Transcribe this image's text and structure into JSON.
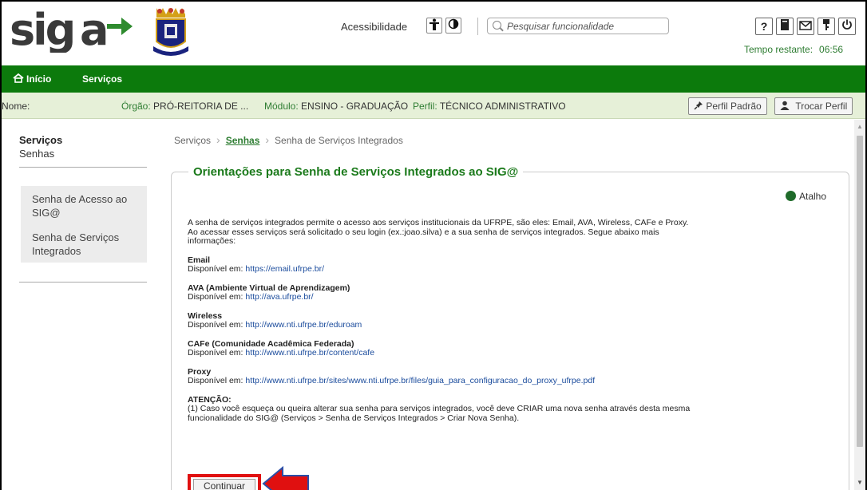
{
  "header": {
    "logo_text": "SIG@",
    "accessibility_label": "Acessibilidade",
    "search_placeholder": "Pesquisar funcionalidade",
    "timer_label": "Tempo restante:",
    "timer_value": "06:56"
  },
  "nav": {
    "home_label": "Início",
    "services_label": "Serviços"
  },
  "infobar": {
    "name_label": "Nome:",
    "orgao_label": "Órgão:",
    "orgao_value": "PRÓ-REITORIA DE ...",
    "modulo_label": "Módulo:",
    "modulo_value": "ENSINO - GRADUAÇÃO",
    "perfil_label": "Perfil:",
    "perfil_value": "TÉCNICO ADMINISTRATIVO",
    "perfil_padrao": "Perfil Padrão",
    "trocar_perfil": "Trocar Perfil"
  },
  "sidebar": {
    "title": "Serviços",
    "subtitle": "Senhas",
    "items": [
      {
        "label": "Senha de Acesso ao SIG@"
      },
      {
        "label": "Senha de Serviços Integrados"
      }
    ]
  },
  "breadcrumb": {
    "item1": "Serviços",
    "item2": "Senhas",
    "item3": "Senha de Serviços Integrados"
  },
  "content": {
    "legend": "Orientações para Senha de Serviços Integrados ao SIG@",
    "atalho": "Atalho",
    "intro": "A senha de serviços integrados permite o acesso aos serviços institucionais da UFRPE, são eles: Email, AVA, Wireless, CAFe e Proxy. Ao acessar esses serviços será solicitado o seu login (ex.:joao.silva) e a sua senha de serviços integrados. Segue abaixo mais informações:",
    "available_label": "Disponível em:",
    "services": [
      {
        "name": "Email",
        "url": "https://email.ufrpe.br/"
      },
      {
        "name": "AVA (Ambiente Virtual de Aprendizagem)",
        "url": "http://ava.ufrpe.br/"
      },
      {
        "name": "Wireless",
        "url": "http://www.nti.ufrpe.br/eduroam"
      },
      {
        "name": "CAFe (Comunidade Acadêmica Federada)",
        "url": "http://www.nti.ufrpe.br/content/cafe"
      },
      {
        "name": "Proxy",
        "url": "http://www.nti.ufrpe.br/sites/www.nti.ufrpe.br/files/guia_para_configuracao_do_proxy_ufrpe.pdf"
      }
    ],
    "attention_title": "ATENÇÃO:",
    "attention_text": "(1) Caso você esqueça ou queira alterar sua senha para serviços integrados, você deve CRIAR uma nova senha através desta mesma funcionalidade do SIG@ (Serviços > Senha de Serviços Integrados > Criar Nova Senha).",
    "continue_button": "Continuar"
  },
  "colors": {
    "nav_green": "#0c7a0c",
    "accent_green": "#2e7d32",
    "highlight_red": "#e01010"
  }
}
